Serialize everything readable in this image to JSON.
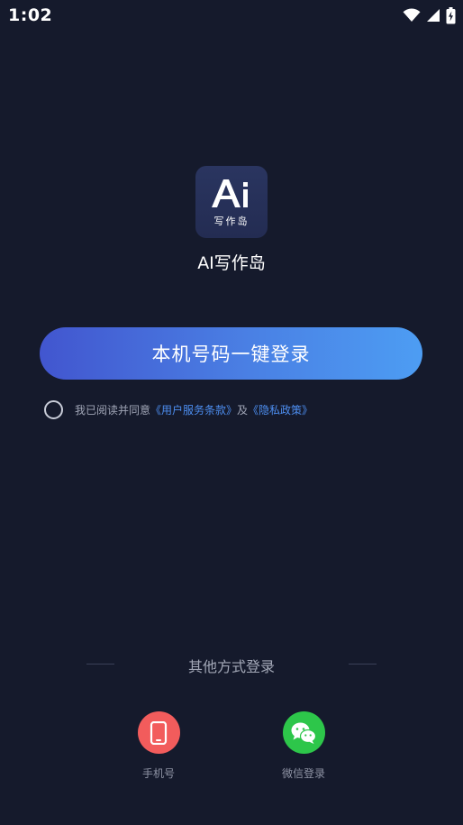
{
  "status_bar": {
    "time": "1:02",
    "icons": [
      "wifi-icon",
      "signal-icon",
      "battery-charging-icon"
    ]
  },
  "app": {
    "logo_mark": "Ai",
    "logo_subtitle": "写作岛",
    "name": "AI写作岛"
  },
  "login": {
    "primary_button_label": "本机号码一键登录"
  },
  "agreement": {
    "prefix": "我已阅读并同意",
    "terms_link": "《用户服务条款》",
    "conjunction": "及",
    "privacy_link": "《隐私政策》",
    "checked": false
  },
  "other_methods": {
    "title": "其他方式登录",
    "items": [
      {
        "label": "手机号",
        "icon": "phone-icon",
        "color": "#f25c5c"
      },
      {
        "label": "微信登录",
        "icon": "wechat-icon",
        "color": "#2dc64a"
      }
    ]
  },
  "colors": {
    "background": "#151a2c",
    "button_gradient_start": "#4256cf",
    "button_gradient_end": "#4d9df3",
    "link": "#4d8ef0"
  }
}
